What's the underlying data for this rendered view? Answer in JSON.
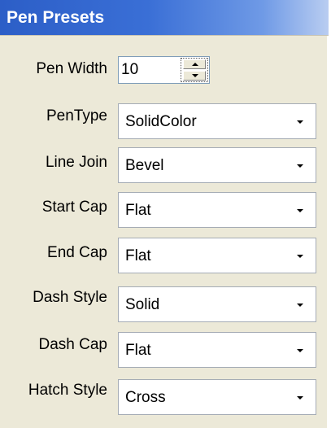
{
  "panel": {
    "title": "Pen Presets"
  },
  "pen_width": {
    "label": "Pen Width",
    "value": "10"
  },
  "fields": [
    {
      "label": "PenType",
      "value": "SolidColor"
    },
    {
      "label": "Line Join",
      "value": "Bevel"
    },
    {
      "label": "Start Cap",
      "value": "Flat"
    },
    {
      "label": "End Cap",
      "value": "Flat"
    },
    {
      "label": "Dash Style",
      "value": "Solid"
    },
    {
      "label": "Dash Cap",
      "value": "Flat"
    },
    {
      "label": "Hatch Style",
      "value": "Cross"
    }
  ],
  "icons": {
    "spin_up": "triangle-up-icon",
    "spin_down": "triangle-down-icon",
    "combo": "chevron-down-icon"
  }
}
